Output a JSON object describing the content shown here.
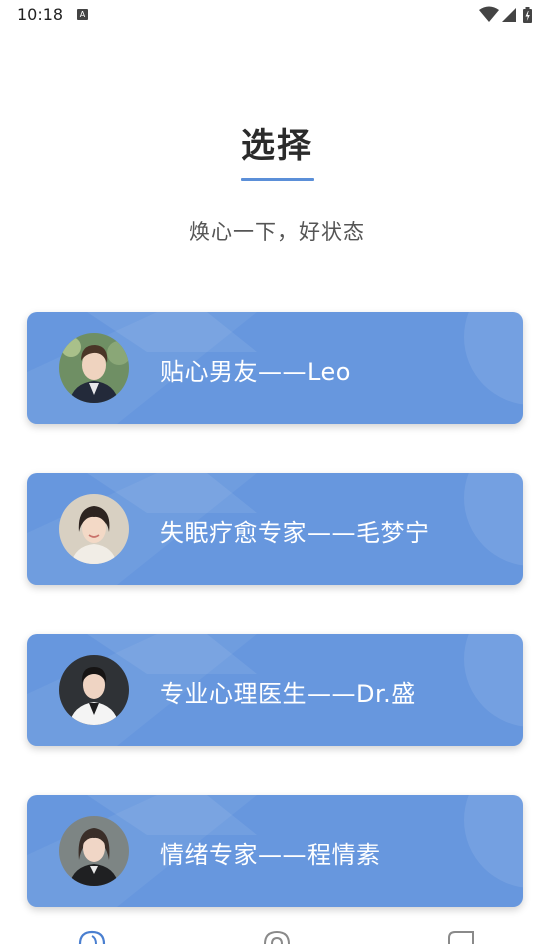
{
  "status_bar": {
    "time": "10:18",
    "app_icon": "A",
    "icons": [
      "wifi-icon",
      "signal-icon",
      "battery-charging-icon"
    ]
  },
  "page": {
    "title": "选择",
    "subtitle": "焕心一下，好状态",
    "accent_color": "#5b8fd8",
    "card_color": "#6797de"
  },
  "cards": [
    {
      "label": "贴心男友——Leo",
      "avatar": "young-man-avatar"
    },
    {
      "label": "失眠疗愈专家——毛梦宁",
      "avatar": "smiling-woman-avatar"
    },
    {
      "label": "专业心理医生——Dr.盛",
      "avatar": "female-doctor-avatar"
    },
    {
      "label": "情绪专家——程情素",
      "avatar": "woman-in-suit-avatar"
    }
  ],
  "bottom_nav": {
    "items": [
      "home-icon",
      "discover-icon",
      "chat-icon"
    ]
  }
}
